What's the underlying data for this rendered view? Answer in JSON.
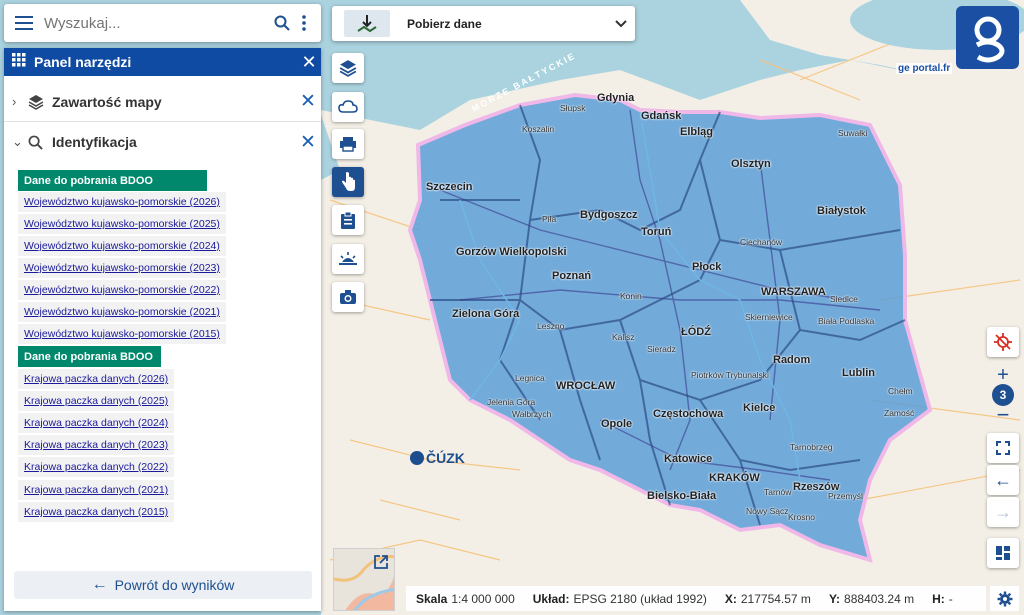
{
  "search": {
    "placeholder": "Wyszukaj..."
  },
  "tool_panel": {
    "title": "Panel narzędzi"
  },
  "sections": [
    {
      "label": "Zawartość mapy",
      "expanded": false
    },
    {
      "label": "Identyfikacja",
      "expanded": true
    }
  ],
  "groups": [
    {
      "header": "Dane do pobrania BDOO",
      "links": [
        "Województwo kujawsko-pomorskie (2026)",
        "Województwo kujawsko-pomorskie (2025)",
        "Województwo kujawsko-pomorskie (2024)",
        "Województwo kujawsko-pomorskie (2023)",
        "Województwo kujawsko-pomorskie (2022)",
        "Województwo kujawsko-pomorskie (2021)",
        "Województwo kujawsko-pomorskie (2015)"
      ]
    },
    {
      "header": "Dane do pobrania BDOO",
      "links": [
        "Krajowa paczka danych (2026)",
        "Krajowa paczka danych (2025)",
        "Krajowa paczka danych (2024)",
        "Krajowa paczka danych (2023)",
        "Krajowa paczka danych (2022)",
        "Krajowa paczka danych (2021)",
        "Krajowa paczka danych (2015)"
      ]
    }
  ],
  "back_button": {
    "label": "Powrót do wyników"
  },
  "download_dropdown": {
    "label": "Pobierz dane"
  },
  "zoom": {
    "level": "3"
  },
  "logo": {
    "text": "ge portal.fr"
  },
  "cuzk": {
    "text": "ČÚZK"
  },
  "status": {
    "scale_label": "Skala",
    "scale_value": "1:4 000 000",
    "crs_label": "Układ:",
    "crs_value": "EPSG 2180 (układ 1992)",
    "x_label": "X:",
    "x_value": "217754.57 m",
    "y_label": "Y:",
    "y_value": "888403.24 m",
    "h_label": "H:",
    "h_value": "-"
  },
  "sea_label": "MORZE BAŁTYCKIE",
  "cities": [
    {
      "name": "Gdynia"
    },
    {
      "name": "Gdańsk"
    },
    {
      "name": "Elbląg"
    },
    {
      "name": "Olsztyn"
    },
    {
      "name": "Szczecin"
    },
    {
      "name": "Koszalin"
    },
    {
      "name": "Słupsk"
    },
    {
      "name": "Suwałki"
    },
    {
      "name": "Białystok"
    },
    {
      "name": "Bydgoszcz"
    },
    {
      "name": "Toruń"
    },
    {
      "name": "Ciechanów"
    },
    {
      "name": "Płock"
    },
    {
      "name": "Gorzów Wielkopolski"
    },
    {
      "name": "Poznań"
    },
    {
      "name": "WARSZAWA"
    },
    {
      "name": "Zielona Góra"
    },
    {
      "name": "Konin"
    },
    {
      "name": "Siedlce"
    },
    {
      "name": "Biała Podlaska"
    },
    {
      "name": "ŁÓDŹ"
    },
    {
      "name": "Kalisz"
    },
    {
      "name": "Leszno"
    },
    {
      "name": "Skierniewice"
    },
    {
      "name": "Sieradz"
    },
    {
      "name": "Radom"
    },
    {
      "name": "Lublin"
    },
    {
      "name": "Legnica"
    },
    {
      "name": "WROCŁAW"
    },
    {
      "name": "Piotrków Trybunalski"
    },
    {
      "name": "Jelenia Góra"
    },
    {
      "name": "Wałbrzych"
    },
    {
      "name": "Opole"
    },
    {
      "name": "Częstochowa"
    },
    {
      "name": "Kielce"
    },
    {
      "name": "Chełm"
    },
    {
      "name": "Zamość"
    },
    {
      "name": "Katowice"
    },
    {
      "name": "KRAKÓW"
    },
    {
      "name": "Tarnów"
    },
    {
      "name": "Rzeszów"
    },
    {
      "name": "Przemyśl"
    },
    {
      "name": "Bielsko-Biała"
    },
    {
      "name": "Nowy Sącz"
    },
    {
      "name": "Krosno"
    },
    {
      "name": "Tarnobrzeg"
    },
    {
      "name": "Piła"
    }
  ]
}
